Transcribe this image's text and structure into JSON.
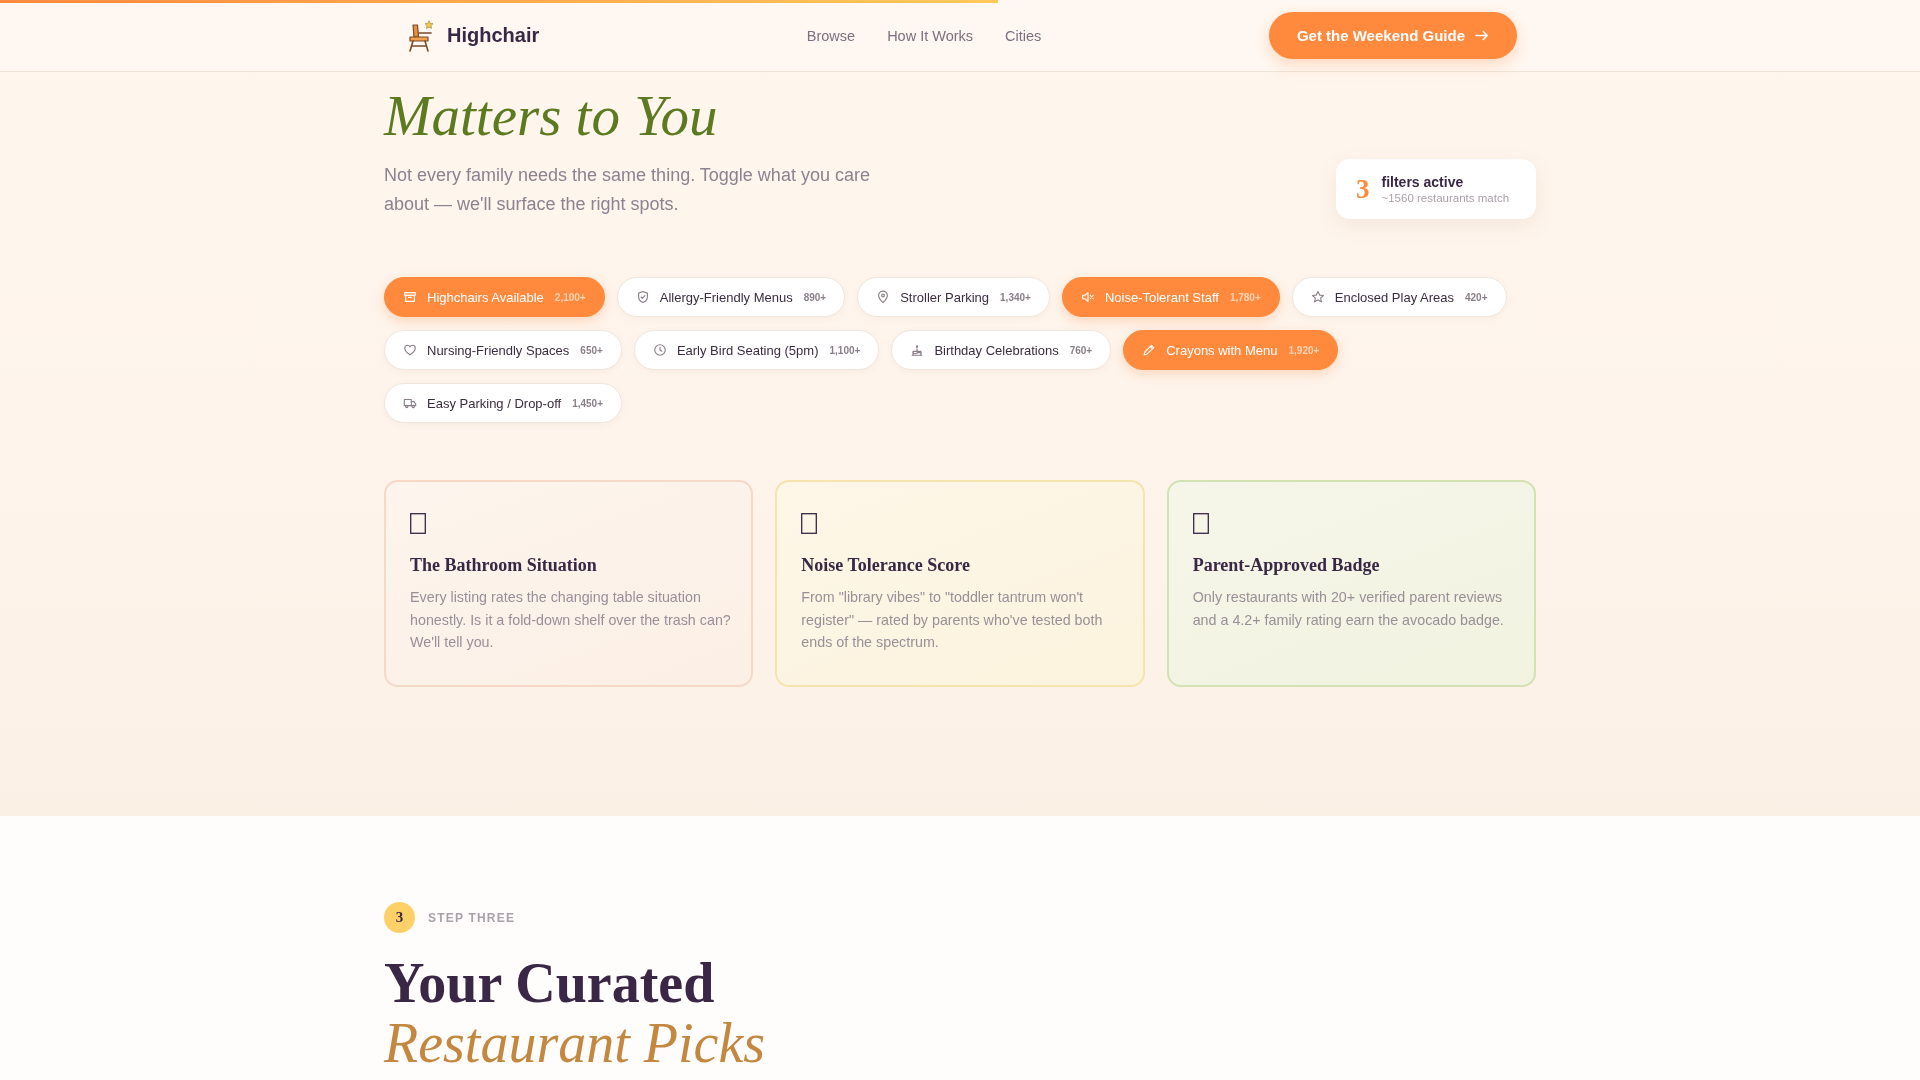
{
  "scroll_progress": {
    "level": 0.52
  },
  "header": {
    "brand": "Highchair",
    "nav": [
      "Browse",
      "How It Works",
      "Cities"
    ],
    "cta": "Get the Weekend Guide"
  },
  "hero": {
    "title_emphasis": "Matters to You",
    "intro": "Not every family needs the same thing. Toggle what you care about — we'll surface the right spots.",
    "filter_summary": {
      "count": "3",
      "label": "filters active",
      "matches": "~1560 restaurants match"
    }
  },
  "filters": [
    {
      "label": "Highchairs Available",
      "count": "2,100+",
      "selected": true
    },
    {
      "label": "Allergy-Friendly Menus",
      "count": "890+",
      "selected": false
    },
    {
      "label": "Stroller Parking",
      "count": "1,340+",
      "selected": false
    },
    {
      "label": "Noise-Tolerant Staff",
      "count": "1,780+",
      "selected": true
    },
    {
      "label": "Enclosed Play Areas",
      "count": "420+",
      "selected": false
    },
    {
      "label": "Nursing-Friendly Spaces",
      "count": "650+",
      "selected": false
    },
    {
      "label": "Early Bird Seating (5pm)",
      "count": "1,100+",
      "selected": false
    },
    {
      "label": "Birthday Celebrations",
      "count": "760+",
      "selected": false
    },
    {
      "label": "Crayons with Menu",
      "count": "1,920+",
      "selected": true
    },
    {
      "label": "Easy Parking / Drop-off",
      "count": "1,450+",
      "selected": false
    }
  ],
  "cards": [
    {
      "title": "The Bathroom Situation",
      "body": "Every listing rates the changing table situation honestly. Is it a fold-down shelf over the trash can? We'll tell you.",
      "color": "#f5d9c6"
    },
    {
      "title": "Noise Tolerance Score",
      "body": "From \"library vibes\" to \"toddler tantrum won't register\" — rated by parents who've tested both ends of the spectrum.",
      "color": "#f6e4ae"
    },
    {
      "title": "Parent-Approved Badge",
      "body": "Only restaurants with 20+ verified parent reviews and a 4.2+ family rating earn the avocado badge.",
      "color": "#d3e2b4"
    }
  ],
  "next_section": {
    "step_number": "3",
    "step_label": "STEP THREE",
    "title": "Your Curated",
    "title_emphasis": "Restaurant Picks"
  }
}
